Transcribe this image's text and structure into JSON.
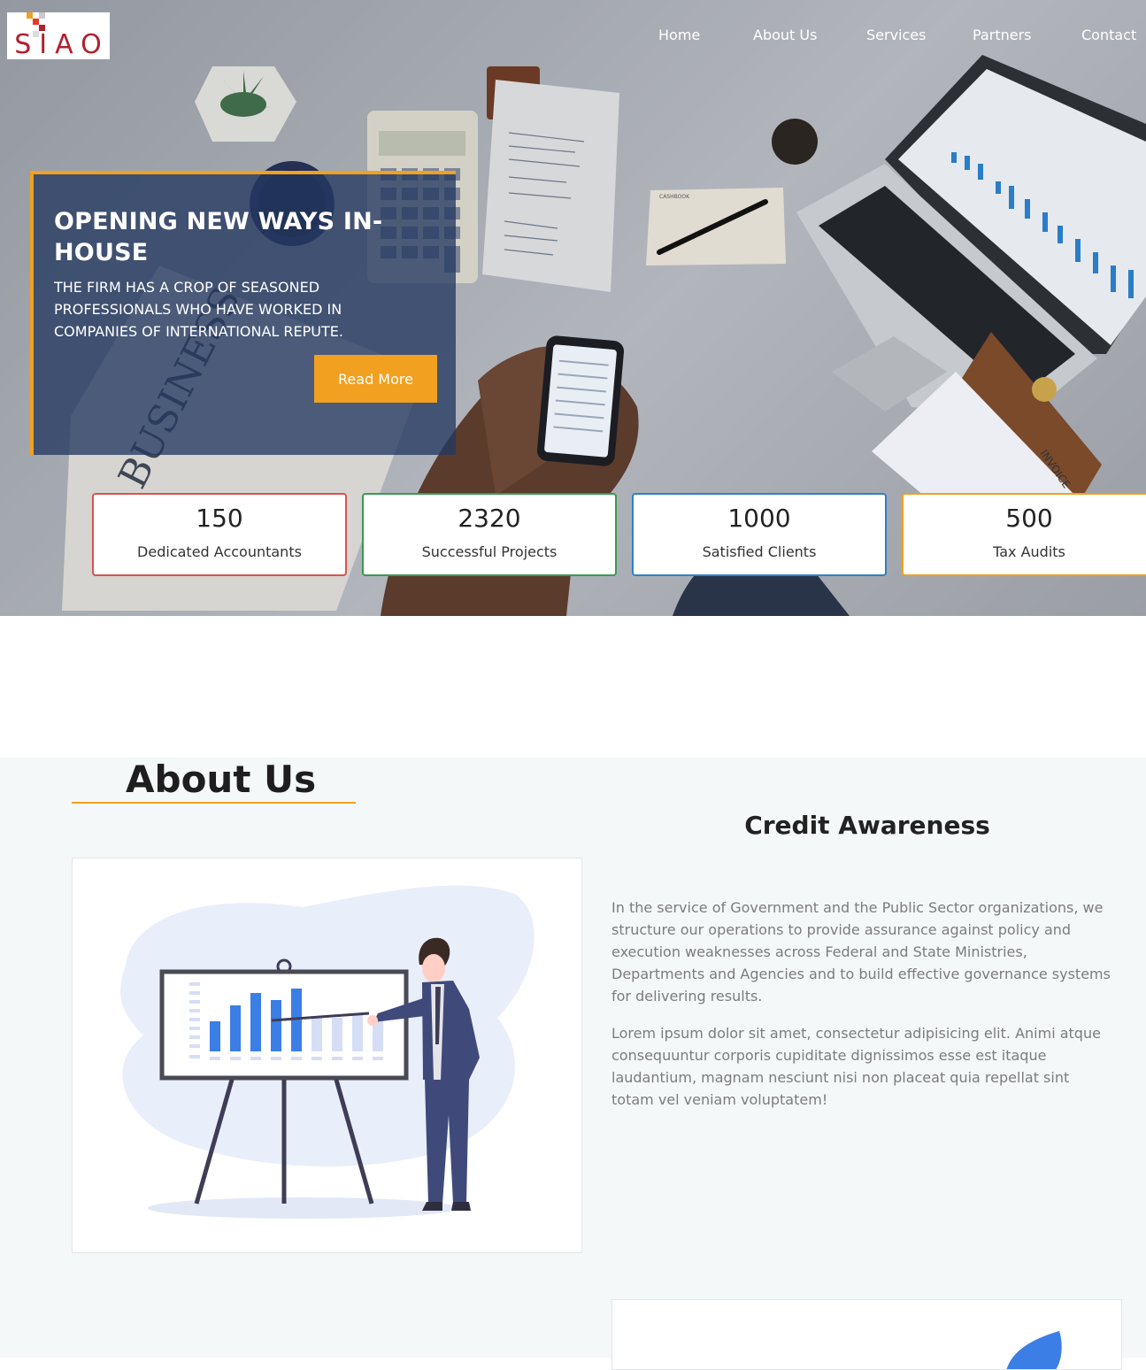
{
  "logo": {
    "text": "SIAO"
  },
  "nav": {
    "items": [
      "Home",
      "About Us",
      "Services",
      "Partners",
      "Contact"
    ]
  },
  "hero": {
    "title": "OPENING NEW WAYS IN-HOUSE",
    "subtitle": "THE FIRM HAS A CROP OF SEASONED PROFESSIONALS WHO HAVE WORKED IN COMPANIES OF INTERNATIONAL REPUTE.",
    "cta_label": "Read More",
    "photo_labels": {
      "newspaper": "BUSINESS",
      "notebook": "CASHBOOK",
      "invoice": "INVOICE"
    }
  },
  "stats": [
    {
      "value": "150",
      "label": "Dedicated Accountants",
      "color": "#d9534f"
    },
    {
      "value": "2320",
      "label": "Successful Projects",
      "color": "#3a9a52"
    },
    {
      "value": "1000",
      "label": "Satisfied Clients",
      "color": "#2f80c9"
    },
    {
      "value": "500",
      "label": "Tax Audits",
      "color": "#f2a01f"
    }
  ],
  "about": {
    "title": "About Us",
    "credit_title": "Credit Awareness",
    "para1": "In the service of Government and the Public Sector organizations, we structure our operations to provide assurance against policy and execution weaknesses across Federal and State Ministries, Departments and Agencies and to build effective governance systems for delivering results.",
    "para2": "Lorem ipsum dolor sit amet, consectetur adipisicing elit. Animi atque consequuntur corporis cupiditate dignissimos esse est itaque laudantium, magnam nesciunt nisi non placeat quia repellat sint totam vel veniam voluptatem!"
  },
  "colors": {
    "accent": "#f2a01f",
    "hero_overlay": "#243860",
    "logo_red": "#b0202e",
    "chart_blue": "#3b7ee6"
  }
}
